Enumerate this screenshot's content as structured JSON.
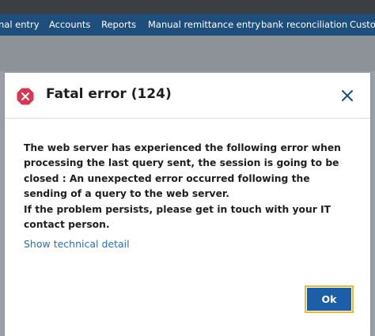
{
  "nav": {
    "items": [
      "nal entry",
      "Accounts",
      "Reports",
      "Manual remittance entry",
      "bank reconciliation",
      "Custo"
    ]
  },
  "dialog": {
    "title": "Fatal error (124)",
    "icon": "error-x-icon",
    "close_icon": "close-icon",
    "message_line1": "The web server has experienced the following error when processing the last query sent, the session is going to be closed : An unexpected error occurred following the sending of a query to the web server.",
    "message_line2": "If the problem persists, please get in touch with your IT contact person.",
    "tech_link": "Show technical detail",
    "ok_label": "Ok"
  },
  "colors": {
    "nav_bg": "#1e4e7b",
    "topbar_bg": "#3b3f44",
    "overlay": "#9a9fa6",
    "error_red": "#d9364f",
    "link_blue": "#2a6fb0",
    "button_blue": "#1c5fa8",
    "focus_ring": "#f2b830"
  }
}
